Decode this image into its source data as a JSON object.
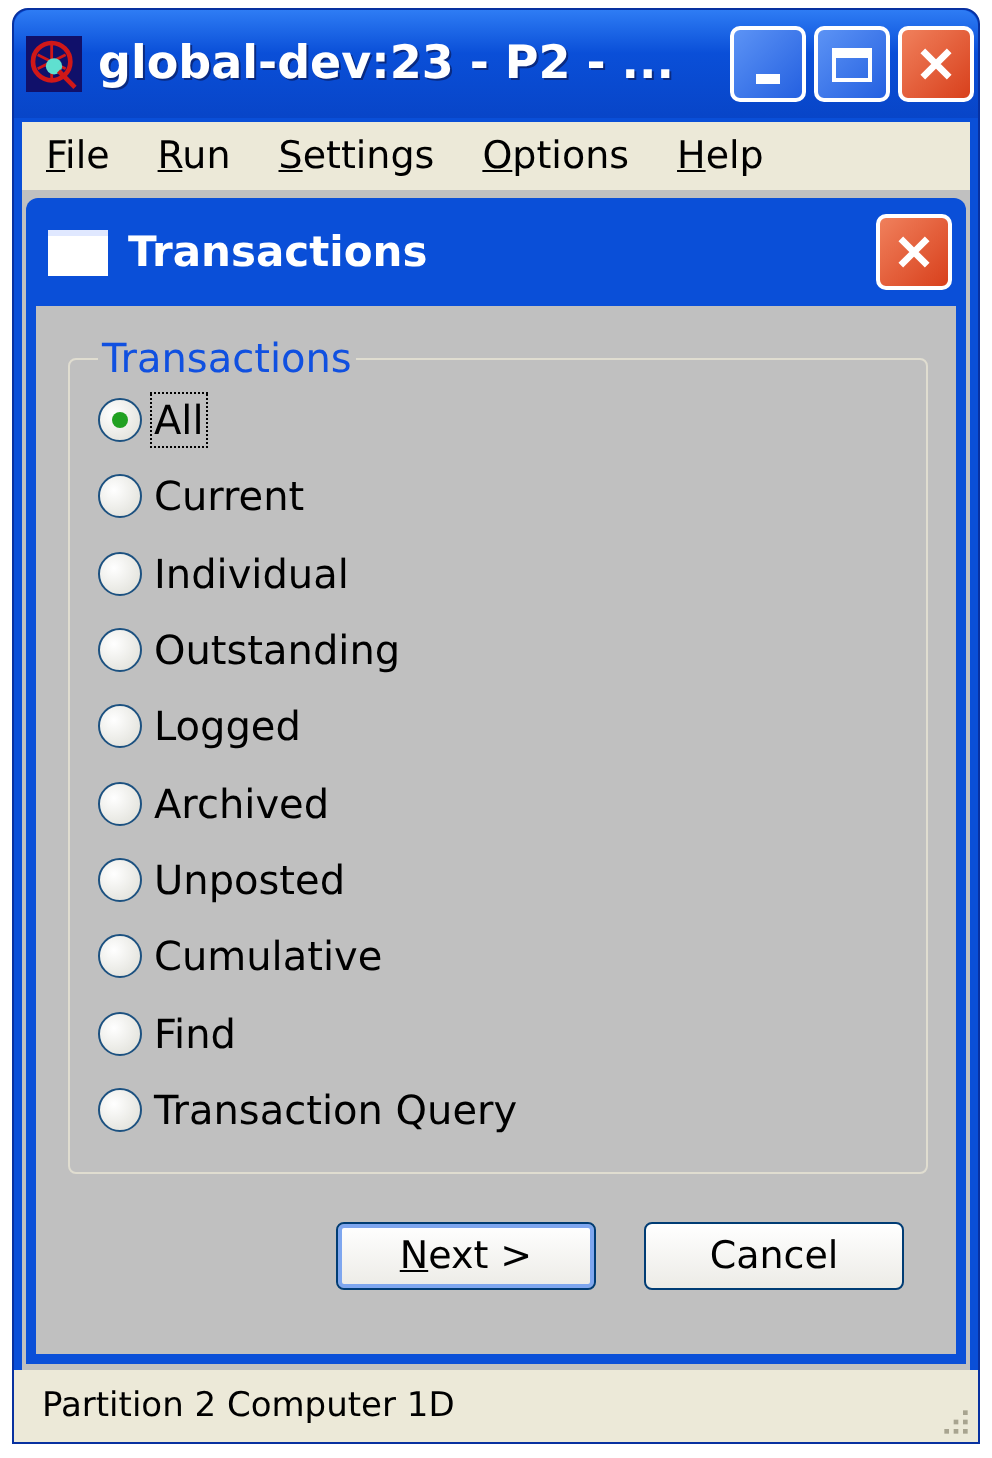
{
  "window": {
    "title": "global-dev:23 - P2 - ..."
  },
  "menu": [
    {
      "label": "File"
    },
    {
      "label": "Run"
    },
    {
      "label": "Settings"
    },
    {
      "label": "Options"
    },
    {
      "label": "Help"
    }
  ],
  "dialog": {
    "title": "Transactions",
    "group": {
      "label": "Transactions",
      "options": [
        {
          "label": "All",
          "selected": true,
          "focused": true
        },
        {
          "label": "Current",
          "selected": false,
          "focused": false
        },
        {
          "label": "Individual",
          "selected": false,
          "focused": false
        },
        {
          "label": "Outstanding",
          "selected": false,
          "focused": false
        },
        {
          "label": "Logged",
          "selected": false,
          "focused": false
        },
        {
          "label": "Archived",
          "selected": false,
          "focused": false
        },
        {
          "label": "Unposted",
          "selected": false,
          "focused": false
        },
        {
          "label": "Cumulative",
          "selected": false,
          "focused": false
        },
        {
          "label": "Find",
          "selected": false,
          "focused": false
        },
        {
          "label": "Transaction Query",
          "selected": false,
          "focused": false
        }
      ]
    },
    "buttons": [
      {
        "label": "Next >",
        "default": true,
        "mnemonic": true
      },
      {
        "label": "Cancel",
        "default": false,
        "mnemonic": false
      }
    ]
  },
  "status_bar": "Partition 2 Computer 1D"
}
